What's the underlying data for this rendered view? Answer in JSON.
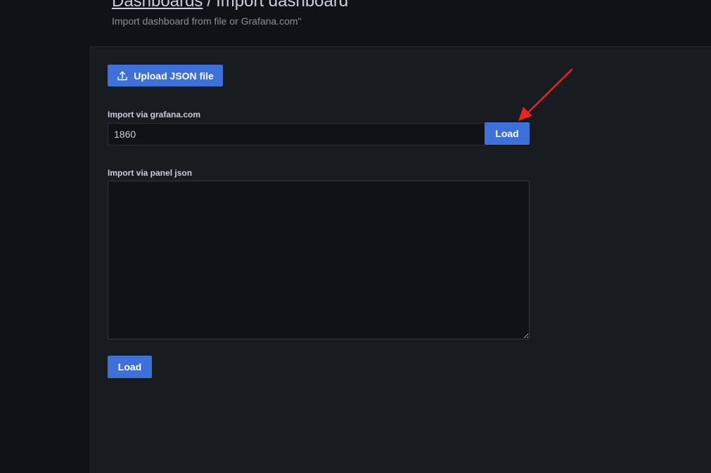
{
  "header": {
    "breadcrumb_link": "Dashboards",
    "breadcrumb_separator": "/",
    "breadcrumb_current": "Import dashboard",
    "subtitle": "Import dashboard from file or Grafana.com\""
  },
  "upload": {
    "label": "Upload JSON file",
    "icon": "upload-icon"
  },
  "grafana_import": {
    "label": "Import via grafana.com",
    "value": "1860",
    "load_label": "Load"
  },
  "json_import": {
    "label": "Import via panel json",
    "value": ""
  },
  "footer": {
    "load_label": "Load"
  },
  "colors": {
    "primary": "#3d71d9",
    "background": "#111217",
    "panel": "#181b1f",
    "annotation_arrow": "#e8241c"
  }
}
